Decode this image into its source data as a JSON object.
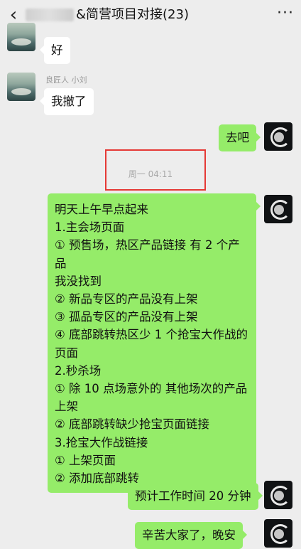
{
  "header": {
    "back_icon": "chevron-left-icon",
    "title_suffix": "&简营项目对接(23)",
    "more_icon": "more-dots-icon"
  },
  "messages": [
    {
      "side": "in",
      "sender": "",
      "text": "好"
    },
    {
      "side": "in",
      "sender": "良匠人 小刘",
      "text": "我撤了"
    },
    {
      "side": "out",
      "text": "去吧"
    },
    {
      "side": "time",
      "text": "周一 04:11"
    },
    {
      "side": "out",
      "lines": [
        "明天上午早点起来",
        "1.主会场页面",
        "① 预售场，热区产品链接 有 2 个产品",
        "我没找到",
        "② 新品专区的产品没有上架",
        "③ 孤品专区的产品没有上架",
        "④ 底部跳转热区少 1 个抢宝大作战的",
        "页面",
        "2.秒杀场",
        "① 除 10 点场意外的 其他场次的产品",
        "上架",
        "② 底部跳转缺少抢宝页面链接",
        "3.抢宝大作战链接",
        "① 上架页面",
        "② 添加底部跳转"
      ]
    },
    {
      "side": "out",
      "text": "预计工作时间 20 分钟"
    },
    {
      "side": "out",
      "text": "辛苦大家了，晚安"
    }
  ]
}
